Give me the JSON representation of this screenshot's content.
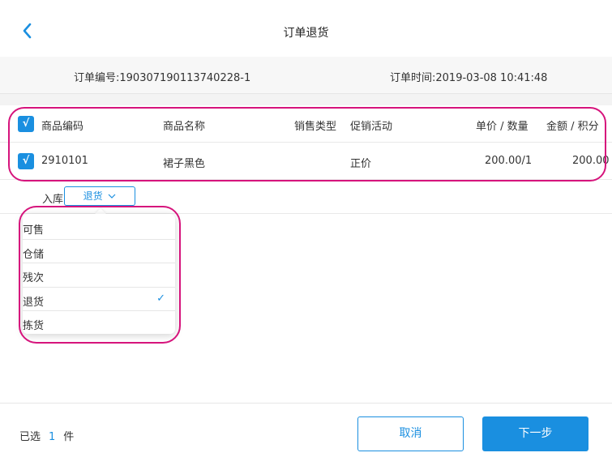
{
  "header": {
    "title": "订单退货",
    "back_icon": "chevron-left-icon"
  },
  "order_info": {
    "number": "订单编号:190307190113740228-1",
    "time": "订单时间:2019-03-08 10:41:48"
  },
  "table": {
    "headers": [
      "商品编码",
      "商品名称",
      "销售类型",
      "促销活动",
      "单价 / 数量",
      "金额 / 积分"
    ],
    "rows": [
      {
        "code": "2910101",
        "name": "裙子黑色",
        "sale_type": "",
        "promotion": "正价",
        "price_qty": "200.00/1",
        "amount": "200.00",
        "checked": true
      }
    ],
    "header_checked": true,
    "check_glyph": "√"
  },
  "sub_row": {
    "label": "入库",
    "select_value": "退货",
    "select_icon": "chevron-down-icon"
  },
  "dropdown": {
    "options": [
      "可售",
      "仓储",
      "残次",
      "退货",
      "拣货"
    ],
    "selected": "退货",
    "check_glyph": "✓"
  },
  "footer": {
    "selected_prefix": "已选",
    "selected_count": "1",
    "selected_suffix": "件",
    "cancel_label": "取消",
    "next_label": "下一步"
  },
  "colors": {
    "accent": "#1a8fe0",
    "highlight": "#d6147c"
  }
}
